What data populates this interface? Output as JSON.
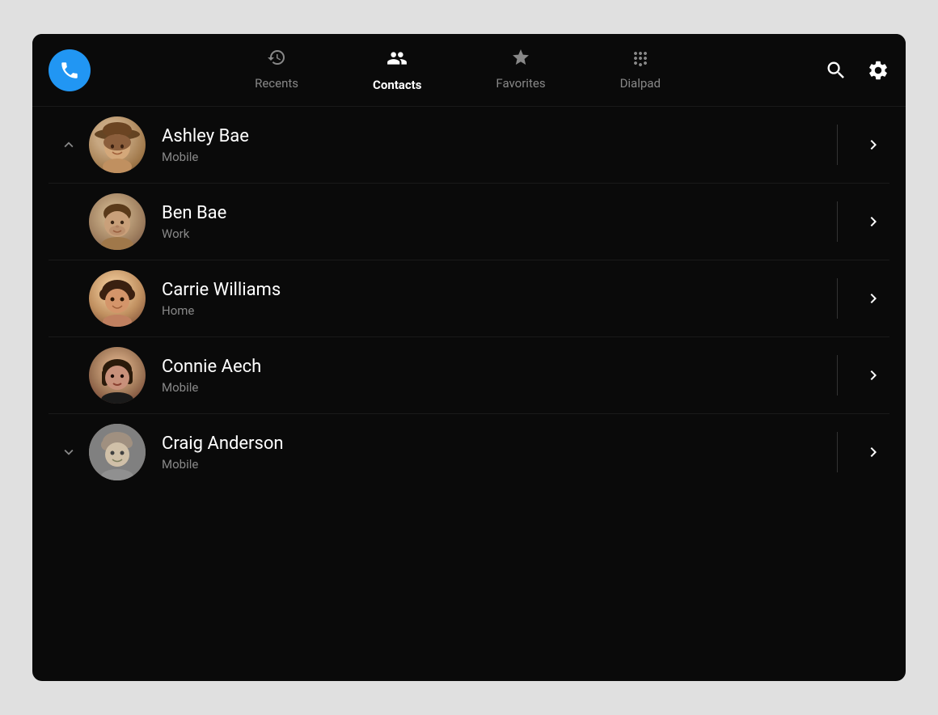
{
  "app": {
    "title": "Phone"
  },
  "nav": {
    "tabs": [
      {
        "id": "recents",
        "label": "Recents",
        "icon": "recents",
        "active": false
      },
      {
        "id": "contacts",
        "label": "Contacts",
        "icon": "contacts",
        "active": true
      },
      {
        "id": "favorites",
        "label": "Favorites",
        "icon": "favorites",
        "active": false
      },
      {
        "id": "dialpad",
        "label": "Dialpad",
        "icon": "dialpad",
        "active": false
      }
    ],
    "search_label": "Search",
    "settings_label": "Settings"
  },
  "contacts": [
    {
      "id": "ashley-bae",
      "name": "Ashley Bae",
      "type": "Mobile",
      "has_up_arrow": true,
      "has_down_arrow": false
    },
    {
      "id": "ben-bae",
      "name": "Ben Bae",
      "type": "Work",
      "has_up_arrow": false,
      "has_down_arrow": false
    },
    {
      "id": "carrie-williams",
      "name": "Carrie Williams",
      "type": "Home",
      "has_up_arrow": false,
      "has_down_arrow": false
    },
    {
      "id": "connie-aech",
      "name": "Connie Aech",
      "type": "Mobile",
      "has_up_arrow": false,
      "has_down_arrow": false
    },
    {
      "id": "craig-anderson",
      "name": "Craig Anderson",
      "type": "Mobile",
      "has_up_arrow": false,
      "has_down_arrow": true
    }
  ]
}
